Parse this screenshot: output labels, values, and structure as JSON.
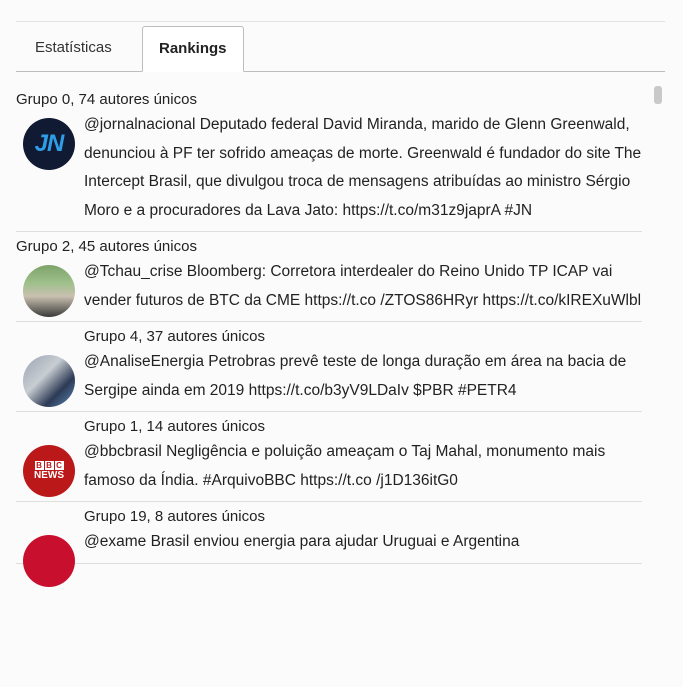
{
  "tabs": [
    {
      "label": "Estatísticas"
    },
    {
      "label": "Rankings"
    }
  ],
  "groups": [
    {
      "title": "Grupo 0, 74 autores únicos",
      "avatar": "jn-logo",
      "avatar_text": "JN",
      "text": "@jornalnacional Deputado federal David Miranda, marido de Glenn Greenwald, denunciou à PF ter sofrido ameaças de morte. Greenwald é fundador do site The Intercept Brasil, que divulgou troca de mensagens atribuídas ao ministro Sérgio Moro e a procuradores da Lava Jato: https://t.co/m31z9japrA #JN"
    },
    {
      "title": "Grupo 2, 45 autores únicos",
      "avatar": "user-photo",
      "text": "@Tchau_crise Bloomberg: Corretora interdealer do Reino Unido TP ICAP vai vender futuros de BTC da CME https://t.co /ZTOS86HRyr https://t.co/kIREXuWlbl"
    },
    {
      "title": "Grupo 4, 37 autores únicos",
      "avatar": "user-photo",
      "text": "@AnaliseEnergia Petrobras prevê teste de longa duração em área na bacia de Sergipe ainda em 2019 https://t.co/b3yV9LDaIv $PBR #PETR4"
    },
    {
      "title": "Grupo 1, 14 autores únicos",
      "avatar": "bbc-news-logo",
      "avatar_text": "NEWS",
      "text": "@bbcbrasil Negligência e poluição ameaçam o Taj Mahal, monumento mais famoso da Índia. #ArquivoBBC https://t.co /j1D136itG0"
    },
    {
      "title": "Grupo 19, 8 autores únicos",
      "avatar": "exame-logo",
      "text": "@exame Brasil enviou energia para ajudar Uruguai e Argentina"
    }
  ]
}
